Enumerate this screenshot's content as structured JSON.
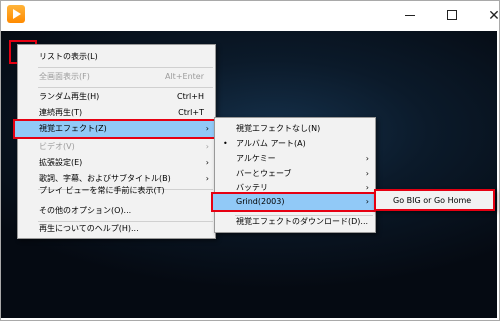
{
  "titlebar": {
    "minimize": "—",
    "maximize": "□",
    "close": "✕"
  },
  "main_menu": {
    "items": [
      {
        "label": "リストの表示(L)"
      },
      {
        "label": "全画面表示(F)",
        "shortcut": "Alt+Enter"
      },
      {
        "label": "ランダム再生(H)",
        "shortcut": "Ctrl+H"
      },
      {
        "label": "連続再生(T)",
        "shortcut": "Ctrl+T"
      },
      {
        "label": "視覚エフェクト(Z)",
        "arrow": "›"
      },
      {
        "label": "ビデオ(V)",
        "arrow": "›"
      },
      {
        "label": "拡張設定(E)",
        "arrow": "›"
      },
      {
        "label": "歌詞、字幕、およびサブタイトル(B)",
        "arrow": "›"
      },
      {
        "label": "プレイ ビューを常に手前に表示(T)"
      },
      {
        "label": "その他のオプション(O)..."
      },
      {
        "label": "再生についてのヘルプ(H)..."
      }
    ]
  },
  "effects_menu": {
    "items": [
      {
        "label": "視覚エフェクトなし(N)"
      },
      {
        "label": "アルバム アート(A)",
        "check": "•"
      },
      {
        "label": "アルケミー",
        "arrow": "›"
      },
      {
        "label": "バーとウェーブ",
        "arrow": "›"
      },
      {
        "label": "バッテリ",
        "arrow": "›"
      },
      {
        "label": "Grind(2003)",
        "arrow": "›"
      },
      {
        "label": "視覚エフェクトのダウンロード(D)..."
      }
    ]
  },
  "grind_menu": {
    "items": [
      {
        "label": "Go BIG or Go Home"
      }
    ]
  }
}
